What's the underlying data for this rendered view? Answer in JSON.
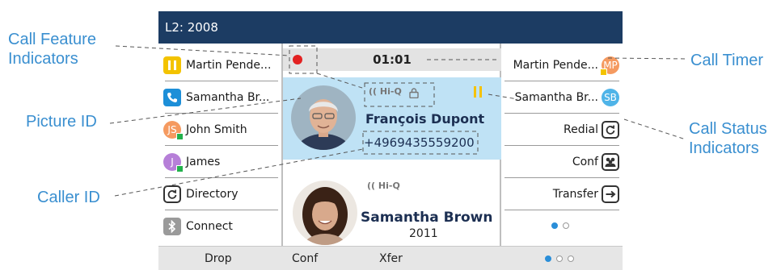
{
  "callouts": {
    "feature_line1": "Call Feature",
    "feature_line2": "Indicators",
    "picture": "Picture ID",
    "caller": "Caller ID",
    "timer": "Call Timer",
    "status_line1": "Call Status",
    "status_line2": "Indicators"
  },
  "screen": {
    "title": "L2: 2008",
    "timer": "01:01",
    "left_keys": [
      {
        "label": "Martin Pende...",
        "icon": "hold-icon",
        "color": "#f3c300"
      },
      {
        "label": "Samantha Br...",
        "icon": "phone-icon",
        "color": "#1d8fd8"
      },
      {
        "label": "John Smith",
        "icon": "JS",
        "color": "#f59a60"
      },
      {
        "label": "James",
        "icon": "J",
        "color": "#b67fd8"
      },
      {
        "label": "Directory",
        "icon": "directory-icon"
      },
      {
        "label": "Connect",
        "icon": "bluetooth-icon",
        "color": "#9a9a9a"
      }
    ],
    "right_keys": [
      {
        "label": "Martin Pende...",
        "icon": "MP",
        "color": "#f59a60"
      },
      {
        "label": "Samantha Br...",
        "icon": "SB",
        "color": "#4fb4e8"
      },
      {
        "label": "Redial",
        "icon": "redial-icon"
      },
      {
        "label": "Conf",
        "icon": "conference-icon"
      },
      {
        "label": "Transfer",
        "icon": "transfer-icon"
      }
    ],
    "active_call": {
      "hd_label": "Hi-Q",
      "name": "François Dupont",
      "number": "+4969435559200"
    },
    "held_call": {
      "hd_label": "Hi-Q",
      "name": "Samantha Brown",
      "number": "2011"
    },
    "softkeys": [
      "Drop",
      "Conf",
      "Xfer"
    ],
    "colors": {
      "title_bar": "#1c3c63",
      "active_call_bg": "#bfe2f5",
      "callout_text": "#3a8fd0",
      "hold": "#f5c200",
      "recording": "#e32222"
    }
  }
}
